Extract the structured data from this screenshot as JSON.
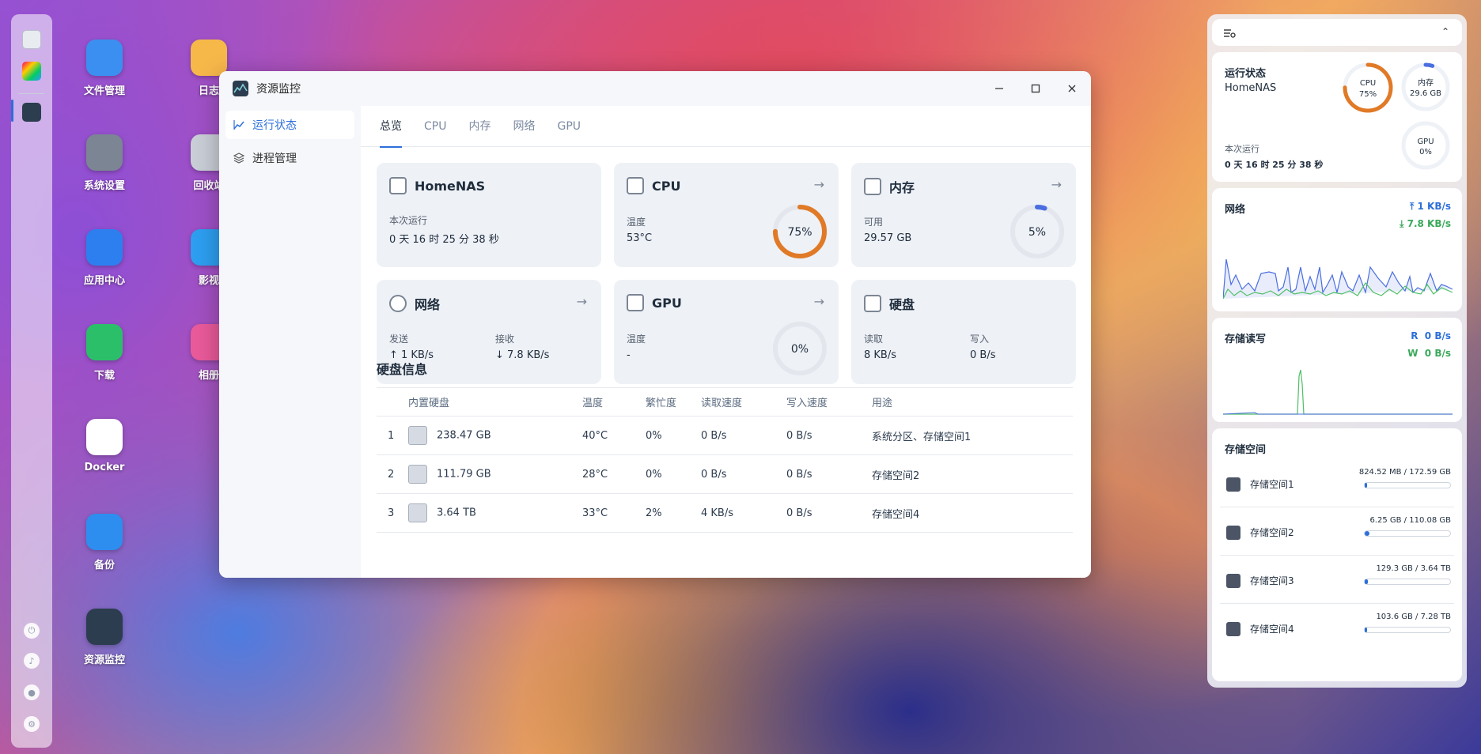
{
  "window": {
    "title": "资源监控"
  },
  "sidebar": {
    "items": [
      {
        "label": "运行状态"
      },
      {
        "label": "进程管理"
      }
    ]
  },
  "tabs": [
    {
      "label": "总览"
    },
    {
      "label": "CPU"
    },
    {
      "label": "内存"
    },
    {
      "label": "网络"
    },
    {
      "label": "GPU"
    }
  ],
  "cards": {
    "system": {
      "title": "HomeNAS",
      "uptime_label": "本次运行",
      "uptime": "0 天 16 时 25 分 38 秒"
    },
    "cpu": {
      "title": "CPU",
      "temp_label": "温度",
      "temp": "53°C",
      "usage": "75%",
      "usage_value": 0.75,
      "color": "#e07a27"
    },
    "memory": {
      "title": "内存",
      "avail_label": "可用",
      "avail": "29.57 GB",
      "usage": "5%",
      "usage_value": 0.05,
      "color": "#4a6ee0"
    },
    "network": {
      "title": "网络",
      "send_label": "发送",
      "send": "↑ 1 KB/s",
      "recv_label": "接收",
      "recv": "↓ 7.8 KB/s"
    },
    "gpu": {
      "title": "GPU",
      "temp_label": "温度",
      "temp": "-",
      "usage": "0%",
      "usage_value": 0
    },
    "disk": {
      "title": "硬盘",
      "read_label": "读取",
      "read": "8 KB/s",
      "write_label": "写入",
      "write": "0 B/s"
    }
  },
  "disk_info": {
    "title": "硬盘信息",
    "headers": [
      "内置硬盘",
      "温度",
      "繁忙度",
      "读取速度",
      "写入速度",
      "用途"
    ],
    "rows": [
      {
        "idx": "1",
        "size": "238.47 GB",
        "temp": "40°C",
        "busy": "0%",
        "read": "0 B/s",
        "write": "0 B/s",
        "use": "系统分区、存储空间1"
      },
      {
        "idx": "2",
        "size": "111.79 GB",
        "temp": "28°C",
        "busy": "0%",
        "read": "0 B/s",
        "write": "0 B/s",
        "use": "存储空间2"
      },
      {
        "idx": "3",
        "size": "3.64 TB",
        "temp": "33°C",
        "busy": "2%",
        "read": "4 KB/s",
        "write": "0 B/s",
        "use": "存储空间4"
      }
    ]
  },
  "desktop": {
    "icons": [
      {
        "label": "文件管理",
        "color": "#3b8ff0"
      },
      {
        "label": "日志",
        "color": "#f7b84a"
      },
      {
        "label": "系统设置",
        "color": "#7b8594"
      },
      {
        "label": "回收站",
        "color": "#c9ced6"
      },
      {
        "label": "应用中心",
        "color": "#2d7ff0",
        "badge": "STORE"
      },
      {
        "label": "影视",
        "color": "#2d9ef0"
      },
      {
        "label": "下载",
        "color": "#2bbf6a"
      },
      {
        "label": "相册",
        "color": "#e95a9a"
      },
      {
        "label": "Docker",
        "color": "#ffffff"
      },
      {
        "label": "备份",
        "color": "#2d8ef0"
      },
      {
        "label": "资源监控",
        "color": "#2c3d4f"
      }
    ]
  },
  "widget": {
    "status": {
      "title": "运行状态",
      "host": "HomeNAS",
      "uptime_label": "本次运行",
      "uptime": "0 天 16 时 25 分 38 秒",
      "cpu_label": "CPU",
      "cpu_value": "75%",
      "cpu_frac": 0.75,
      "mem_label": "内存",
      "mem_value": "29.6 GB",
      "mem_frac": 0.05,
      "gpu_label": "GPU",
      "gpu_value": "0%",
      "gpu_frac": 0
    },
    "network": {
      "title": "网络",
      "up": "1 KB/s",
      "down": "7.8 KB/s"
    },
    "storage_io": {
      "title": "存储读写",
      "read_label": "R",
      "read": "0 B/s",
      "write_label": "W",
      "write": "0 B/s"
    },
    "pools": {
      "title": "存储空间",
      "items": [
        {
          "name": "存储空间1",
          "usage": "824.52 MB / 172.59 GB",
          "frac": 0.005
        },
        {
          "name": "存储空间2",
          "usage": "6.25 GB / 110.08 GB",
          "frac": 0.057
        },
        {
          "name": "存储空间3",
          "usage": "129.3 GB / 3.64 TB",
          "frac": 0.035
        },
        {
          "name": "存储空间4",
          "usage": "103.6 GB / 7.28 TB",
          "frac": 0.014
        }
      ]
    }
  }
}
